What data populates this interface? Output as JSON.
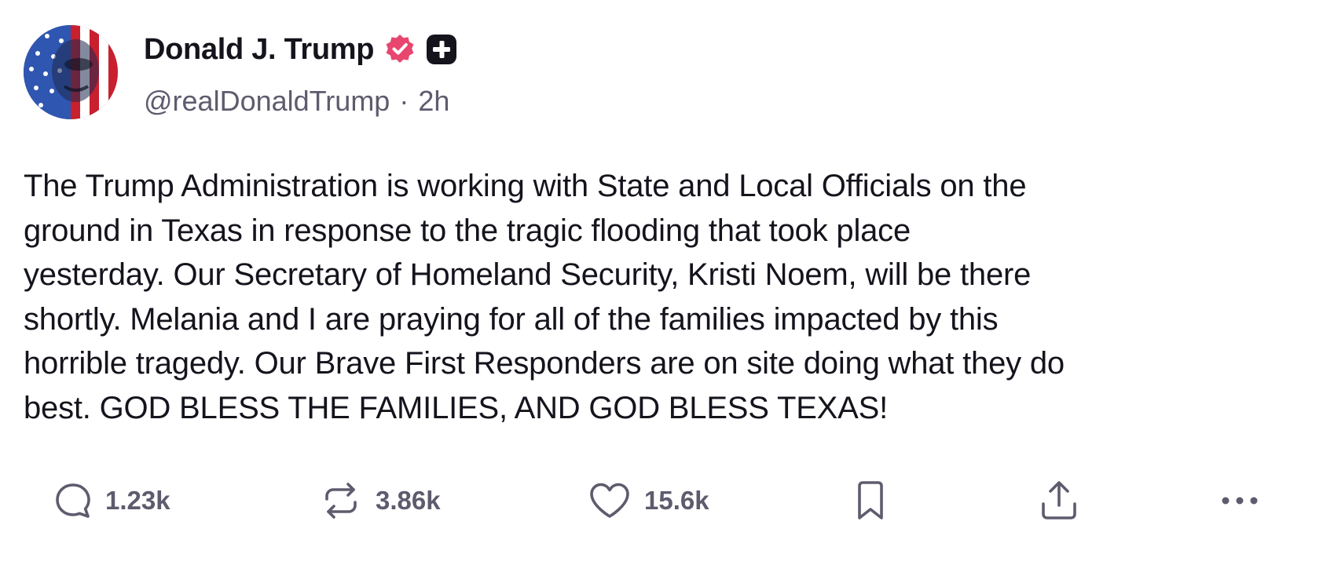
{
  "post": {
    "author": {
      "display_name": "Donald J. Trump",
      "handle": "@realDonaldTrump",
      "verified_icon": "verified-badge-icon",
      "verified_color": "#e8466f",
      "plus_icon": "plus-square-icon"
    },
    "separator": "·",
    "timestamp": "2h",
    "body_lines": [
      "The Trump Administration is working with State and Local Officials on the",
      "ground in Texas in response to the tragic flooding that took place",
      "yesterday. Our Secretary of Homeland Security, Kristi Noem, will be there",
      "shortly. Melania and I are praying for all of the families impacted by this",
      "horrible tragedy. Our Brave First Responders are on site doing what they do",
      "best. GOD BLESS THE FAMILIES, AND GOD BLESS TEXAS!"
    ],
    "actions": {
      "reply": {
        "icon": "reply-bubble-icon",
        "count": "1.23k"
      },
      "repost": {
        "icon": "repost-arrows-icon",
        "count": "3.86k"
      },
      "like": {
        "icon": "heart-icon",
        "count": "15.6k"
      },
      "bookmark": {
        "icon": "bookmark-icon"
      },
      "share": {
        "icon": "share-upload-icon"
      },
      "more": {
        "icon": "more-dots-icon"
      }
    }
  },
  "colors": {
    "text_primary": "#15131c",
    "text_secondary": "#5f5b6e",
    "background": "#ffffff",
    "verified": "#e8466f"
  }
}
